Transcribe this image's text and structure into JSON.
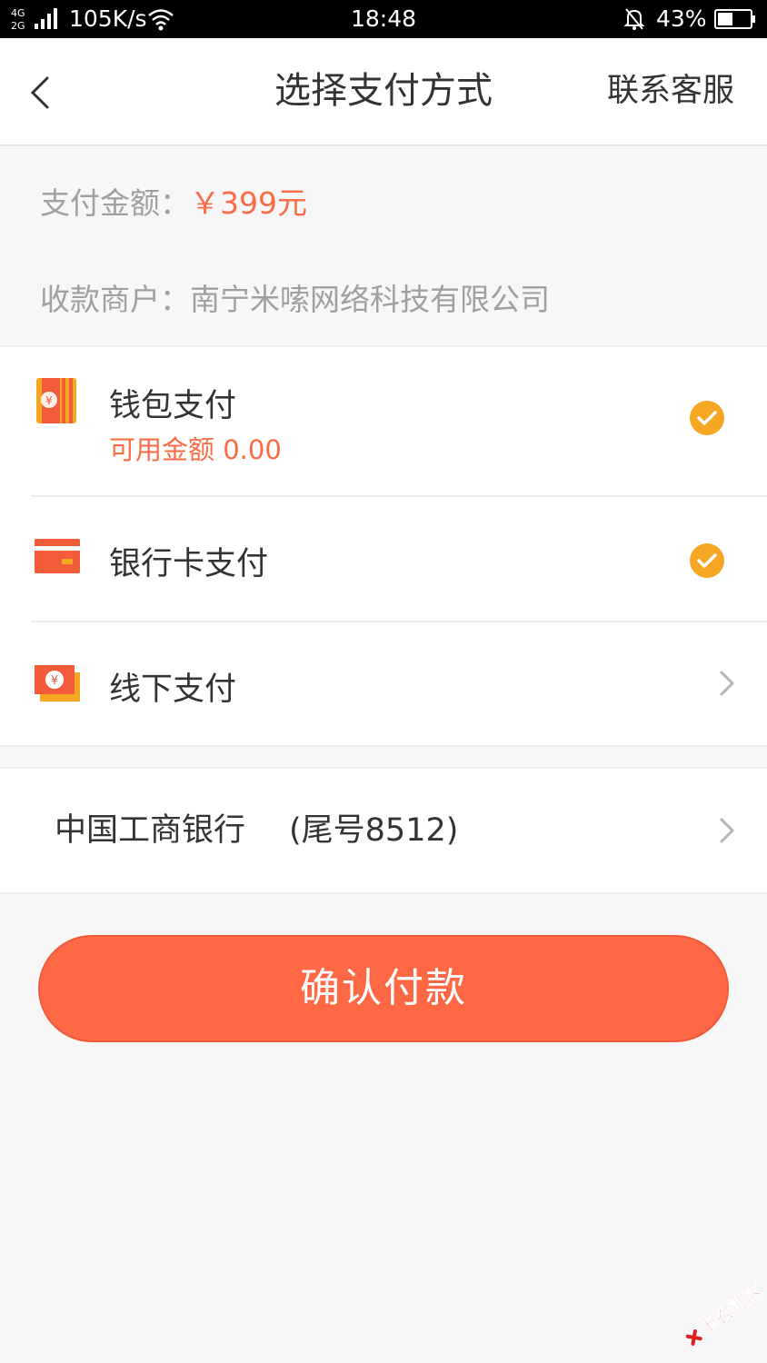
{
  "status_bar": {
    "network": "4G 2G",
    "speed": "105K/s",
    "time": "18:48",
    "battery": "43%"
  },
  "header": {
    "title": "选择支付方式",
    "service_link": "联系客服"
  },
  "order": {
    "amount_label": "支付金额：",
    "amount_value": "￥399元",
    "merchant_label": "收款商户：",
    "merchant_value": "南宁米嗦网络科技有限公司"
  },
  "payment_methods": [
    {
      "label": "钱包支付",
      "sub": "可用金额 0.00",
      "icon": "wallet-icon",
      "state": "checked"
    },
    {
      "label": "银行卡支付",
      "icon": "bank-card-icon",
      "state": "checked"
    },
    {
      "label": "线下支付",
      "icon": "cash-icon",
      "state": "arrow"
    }
  ],
  "bank_card": {
    "name": "中国工商银行",
    "tail": "(尾号8512)"
  },
  "confirm_button": "确认付款",
  "watermark": "卡农社区",
  "colors": {
    "accent": "#fe6845",
    "amount": "#fb6b46",
    "check": "#f5a623",
    "wallet_icon": "#f5a623",
    "card_icon": "#f25c3b"
  }
}
